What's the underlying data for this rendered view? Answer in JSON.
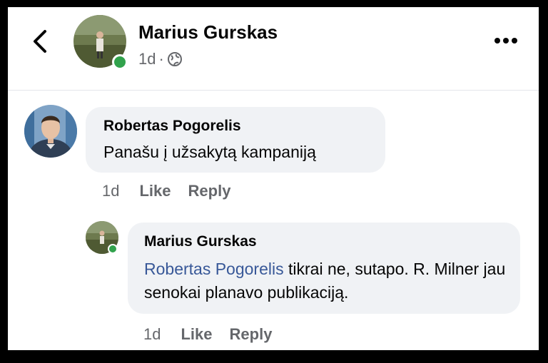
{
  "post": {
    "author": "Marius Gurskas",
    "time": "1d",
    "separator": "·",
    "audience_icon": "globe-icon"
  },
  "comments": [
    {
      "author": "Robertas Pogorelis",
      "text": "Panašu į užsakytą kampaniją",
      "time": "1d",
      "like_label": "Like",
      "reply_label": "Reply"
    }
  ],
  "reply": {
    "author": "Marius Gurskas",
    "mention": "Robertas Pogorelis",
    "text": " tikrai ne, sutapo. R. Milner jau senokai planavo publikaciją.",
    "time": "1d",
    "like_label": "Like",
    "reply_label": "Reply"
  },
  "colors": {
    "online": "#31a24c",
    "mention": "#385898",
    "bubble": "#f0f2f5"
  }
}
